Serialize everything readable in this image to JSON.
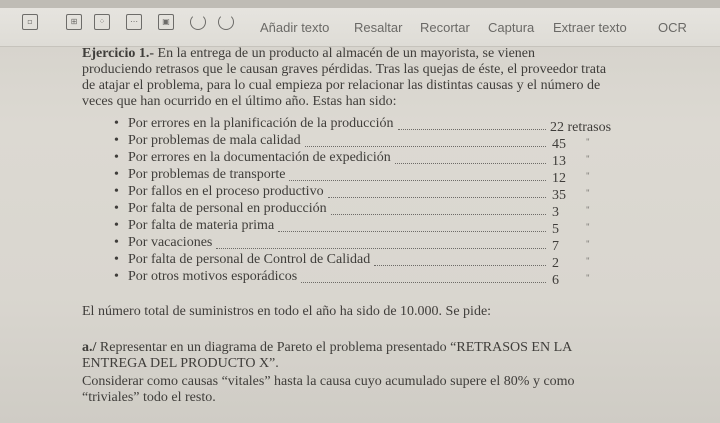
{
  "toolbar": {
    "actions": [
      "Añadir texto",
      "Resaltar",
      "Recortar",
      "Captura",
      "Extraer texto",
      "OCR"
    ],
    "icons": [
      "page-icon",
      "layout-icon",
      "grid-icon",
      "select-icon",
      "frame-icon",
      "undo-icon",
      "redo-icon"
    ]
  },
  "document": {
    "heading": "Ejercicio 1.-",
    "intro_lines": [
      "En la entrega de un producto al almacén de un mayorista, se vienen",
      "produciendo retrasos que le causan graves pérdidas. Tras las quejas de éste, el proveedor trata",
      "de atajar el problema, para lo cual empieza por relacionar las distintas causas y el número de",
      "veces que han ocurrido en el último año. Estas han sido:"
    ],
    "causes": [
      {
        "text": "Por errores en la planificación de la producción",
        "value": "22 retrasos",
        "ditto": ""
      },
      {
        "text": "Por problemas de mala calidad",
        "value": "45",
        "ditto": "\""
      },
      {
        "text": "Por errores en la documentación de expedición",
        "value": "13",
        "ditto": "\""
      },
      {
        "text": "Por problemas de transporte",
        "value": "12",
        "ditto": "\""
      },
      {
        "text": "Por fallos en el proceso productivo",
        "value": "35",
        "ditto": "\""
      },
      {
        "text": "Por falta de personal en producción",
        "value": "3",
        "ditto": "\""
      },
      {
        "text": "Por falta de materia prima",
        "value": "5",
        "ditto": "\""
      },
      {
        "text": "Por vacaciones",
        "value": "7",
        "ditto": "\""
      },
      {
        "text": "Por falta de personal de Control de Calidad",
        "value": "2",
        "ditto": "\""
      },
      {
        "text": "Por otros motivos esporádicos",
        "value": "6",
        "ditto": "\""
      }
    ],
    "total_line": "El número total de suministros en todo el año ha sido de 10.000. Se pide:",
    "part_a_label": "a./",
    "part_a_lines": [
      "Representar en un diagrama de Pareto el problema presentado “RETRASOS EN LA",
      "ENTREGA DEL PRODUCTO X”."
    ],
    "consider_lines": [
      "Considerar como causas “vitales” hasta la causa cuyo acumulado supere el 80% y como",
      "“triviales” todo el resto."
    ]
  }
}
